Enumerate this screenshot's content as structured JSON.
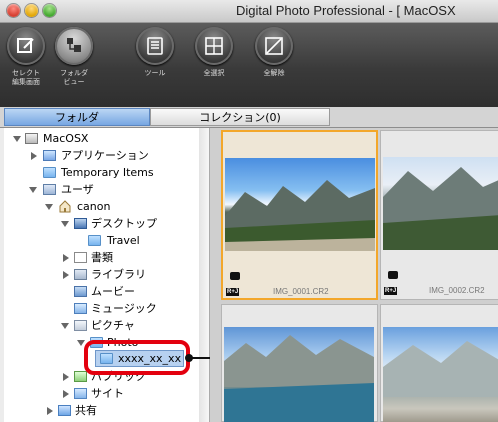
{
  "window": {
    "title": "Digital Photo Professional - [ MacOSX"
  },
  "toolbar": {
    "buttons": [
      {
        "label": "セレクト\n編集画面",
        "icon": "select-edit-icon"
      },
      {
        "label": "フォルダ\nビュー",
        "icon": "folder-view-icon"
      },
      {
        "label": "ツール",
        "icon": "tool-icon"
      },
      {
        "label": "全選択",
        "icon": "select-all-icon"
      },
      {
        "label": "全解除",
        "icon": "deselect-all-icon"
      }
    ]
  },
  "tabs": {
    "folder": "フォルダ",
    "collection": "コレクション(0)"
  },
  "tree": {
    "root": "MacOSX",
    "applications": "アプリケーション",
    "temporary": "Temporary Items",
    "users": "ユーザ",
    "canon": "canon",
    "desktop": "デスクトップ",
    "travel": "Travel",
    "documents": "書類",
    "library": "ライブラリ",
    "movies": "ムービー",
    "music": "ミュージック",
    "pictures": "ピクチャ",
    "photo": "Photo",
    "selected": "xxxx_xx_xx",
    "public": "パブリック",
    "sites": "サイト",
    "shared": "共有"
  },
  "thumbnails": [
    {
      "name": "IMG_0001.CR2",
      "badge": "R+J",
      "selected": true
    },
    {
      "name": "IMG_0002.CR2",
      "badge": "R+J",
      "selected": false
    }
  ],
  "colors": {
    "selection_ring": "#e3000e",
    "thumb_selected_border": "#f3a72a",
    "tab_active": "#77a6e2"
  }
}
